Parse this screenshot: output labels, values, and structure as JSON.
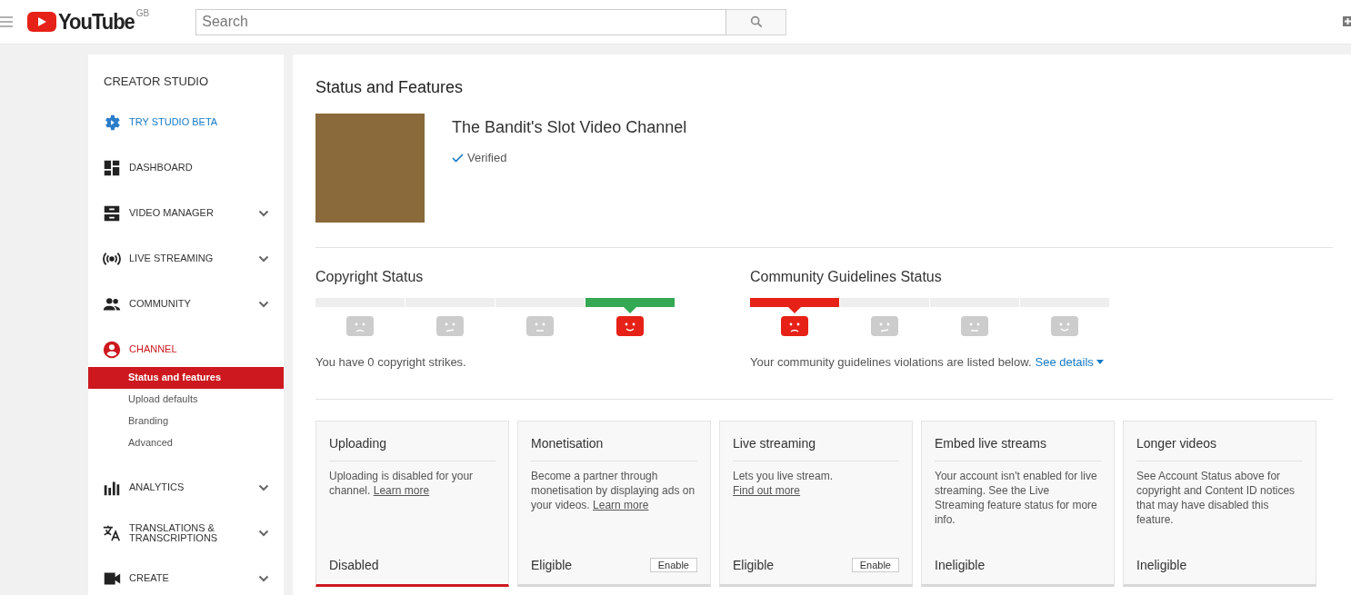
{
  "header": {
    "logo": "YouTube",
    "region": "GB",
    "search": {
      "placeholder": "Search"
    }
  },
  "sidebar": {
    "title": "CREATOR STUDIO",
    "items": [
      {
        "kind": "beta",
        "label": "TRY STUDIO BETA",
        "expandable": false,
        "selected": false
      },
      {
        "kind": "dashboard",
        "label": "DASHBOARD",
        "expandable": false,
        "selected": false
      },
      {
        "kind": "video",
        "label": "VIDEO MANAGER",
        "expandable": true,
        "selected": false
      },
      {
        "kind": "live",
        "label": "LIVE STREAMING",
        "expandable": true,
        "selected": false
      },
      {
        "kind": "community",
        "label": "COMMUNITY",
        "expandable": true,
        "selected": false
      },
      {
        "kind": "channel",
        "label": "CHANNEL",
        "expandable": false,
        "selected": true,
        "children": [
          {
            "label": "Status and features",
            "selected": true
          },
          {
            "label": "Upload defaults",
            "selected": false
          },
          {
            "label": "Branding",
            "selected": false
          },
          {
            "label": "Advanced",
            "selected": false
          }
        ]
      },
      {
        "kind": "analytics",
        "label": "ANALYTICS",
        "expandable": true,
        "selected": false
      },
      {
        "kind": "translate",
        "label": "TRANSLATIONS & TRANSCRIPTIONS",
        "expandable": true,
        "selected": false
      },
      {
        "kind": "create",
        "label": "CREATE",
        "expandable": true,
        "selected": false
      }
    ]
  },
  "main": {
    "title": "Status and Features",
    "channel": {
      "name": "The Bandit's Slot Video Channel",
      "verified": "Verified"
    },
    "statuses": [
      {
        "title": "Copyright Status",
        "color": "#34a853",
        "segments": [
          {
            "kind": "sad",
            "selected": false
          },
          {
            "kind": "slight",
            "selected": false
          },
          {
            "kind": "neutral",
            "selected": false
          },
          {
            "kind": "happy",
            "selected": true
          }
        ],
        "text": "You have 0 copyright strikes."
      },
      {
        "title": "Community Guidelines Status",
        "color": "#e62117",
        "segments": [
          {
            "kind": "sad",
            "selected": true
          },
          {
            "kind": "slight",
            "selected": false
          },
          {
            "kind": "neutral",
            "selected": false
          },
          {
            "kind": "happy",
            "selected": false
          }
        ],
        "text": "Your community guidelines violations are listed below.",
        "link": "See details"
      }
    ],
    "features": [
      {
        "title": "Uploading",
        "text": "Uploading is disabled for your channel.",
        "link": "Learn more",
        "status": "Disabled",
        "disabled": true
      },
      {
        "title": "Monetisation",
        "text": "Become a partner through monetisation by displaying ads on your videos.",
        "link": "Learn more",
        "status": "Eligible",
        "disabled": false,
        "button": "Enable"
      },
      {
        "title": "Live streaming",
        "text": "Lets you live stream.",
        "link": "Find out more",
        "status": "Eligible",
        "disabled": false,
        "button": "Enable"
      },
      {
        "title": "Embed live streams",
        "text": "Your account isn't enabled for live streaming. See the Live Streaming feature status for more info.",
        "status": "Ineligible",
        "disabled": false
      },
      {
        "title": "Longer videos",
        "text": "See Account Status above for copyright and Content ID notices that may have disabled this feature.",
        "status": "Ineligible",
        "disabled": false
      }
    ]
  }
}
